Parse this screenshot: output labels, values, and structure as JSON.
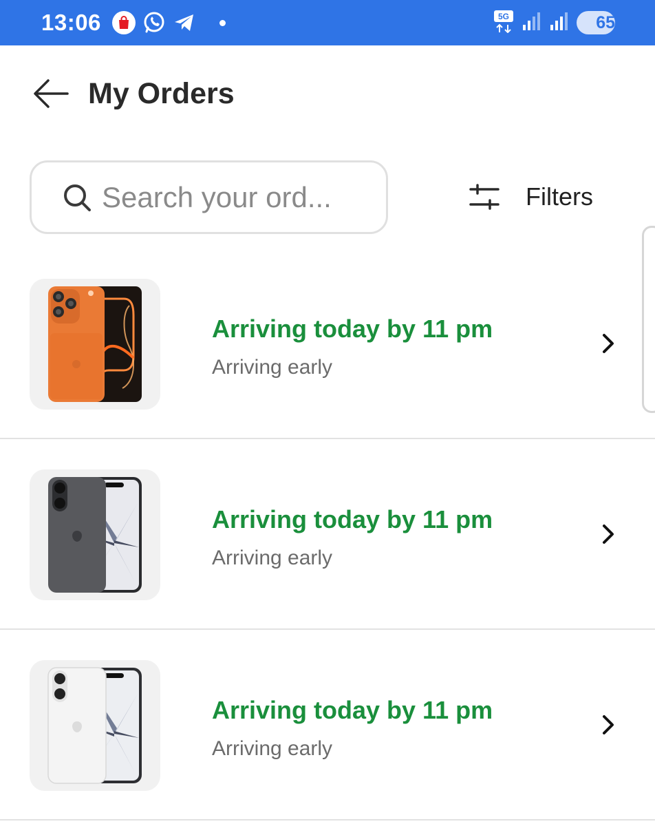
{
  "status_bar": {
    "time": "13:06",
    "apps": [
      "shopping-bag-app-icon",
      "whatsapp-icon",
      "telegram-icon"
    ],
    "network": "5G",
    "battery": "65",
    "battery_level": 0.65,
    "background": "#2f74e6"
  },
  "header": {
    "title": "My Orders",
    "back_icon": "arrow-left-icon"
  },
  "search": {
    "placeholder": "Search your ord...",
    "icon": "search-icon"
  },
  "filters": {
    "label": "Filters",
    "icon": "sliders-icon"
  },
  "orders": [
    {
      "status": "Arriving today by 11 pm",
      "subtitle": "Arriving early",
      "product_icon": "orange-phone-image"
    },
    {
      "status": "Arriving today by 11 pm",
      "subtitle": "Arriving early",
      "product_icon": "black-phone-image"
    },
    {
      "status": "Arriving today by 11 pm",
      "subtitle": "Arriving early",
      "product_icon": "white-phone-image"
    }
  ],
  "colors": {
    "status_green": "#1a8f3c",
    "subtitle_gray": "#6b6b6b"
  }
}
